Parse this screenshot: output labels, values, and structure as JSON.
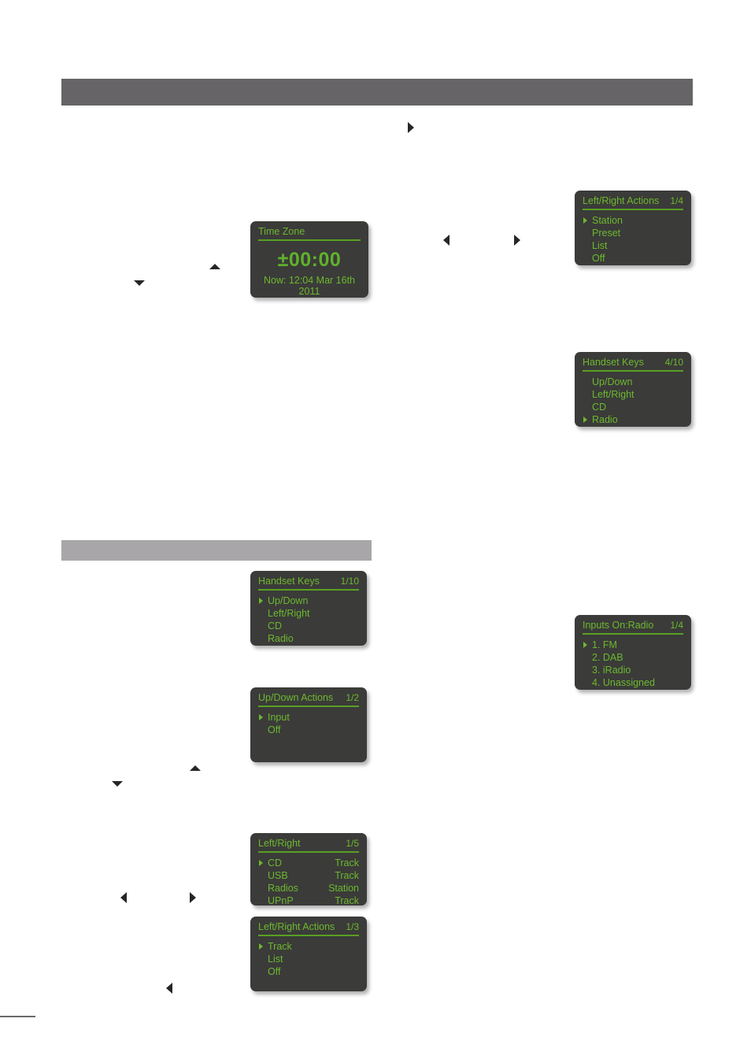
{
  "page": {
    "bands": [
      {
        "name": "section-heading-bar-primary",
        "text": ""
      },
      {
        "name": "section-heading-bar-secondary",
        "text": ""
      }
    ]
  },
  "panels": {
    "time_zone": {
      "title": "Time Zone",
      "count": "",
      "value": "±00:00",
      "now": "Now: 12:04 Mar 16th 2011"
    },
    "left_right_actions_radio": {
      "title": "Left/Right Actions",
      "count": "1/4",
      "rows": [
        {
          "label": "Station",
          "value": "",
          "selected": true
        },
        {
          "label": "Preset",
          "value": "",
          "selected": false
        },
        {
          "label": "List",
          "value": "",
          "selected": false
        },
        {
          "label": "Off",
          "value": "",
          "selected": false
        }
      ]
    },
    "handset_keys_radio": {
      "title": "Handset Keys",
      "count": "4/10",
      "rows": [
        {
          "label": "Up/Down",
          "value": "",
          "selected": false
        },
        {
          "label": "Left/Right",
          "value": "",
          "selected": false
        },
        {
          "label": "CD",
          "value": "",
          "selected": false
        },
        {
          "label": "Radio",
          "value": "",
          "selected": true
        }
      ]
    },
    "inputs_on_radio": {
      "title": "Inputs On:Radio",
      "count": "1/4",
      "rows": [
        {
          "label": "1. FM",
          "value": "",
          "selected": true
        },
        {
          "label": "2. DAB",
          "value": "",
          "selected": false
        },
        {
          "label": "3. iRadio",
          "value": "",
          "selected": false
        },
        {
          "label": "4. Unassigned",
          "value": "",
          "selected": false
        }
      ]
    },
    "handset_keys_updown": {
      "title": "Handset Keys",
      "count": "1/10",
      "rows": [
        {
          "label": "Up/Down",
          "value": "",
          "selected": true
        },
        {
          "label": "Left/Right",
          "value": "",
          "selected": false
        },
        {
          "label": "CD",
          "value": "",
          "selected": false
        },
        {
          "label": "Radio",
          "value": "",
          "selected": false
        }
      ]
    },
    "up_down_actions": {
      "title": "Up/Down Actions",
      "count": "1/2",
      "rows": [
        {
          "label": "Input",
          "value": "",
          "selected": true
        },
        {
          "label": "Off",
          "value": "",
          "selected": false
        }
      ]
    },
    "left_right": {
      "title": "Left/Right",
      "count": "1/5",
      "rows": [
        {
          "label": "CD",
          "value": "Track",
          "selected": true
        },
        {
          "label": "USB",
          "value": "Track",
          "selected": false
        },
        {
          "label": "Radios",
          "value": "Station",
          "selected": false
        },
        {
          "label": "UPnP",
          "value": "Track",
          "selected": false
        }
      ]
    },
    "left_right_actions_track": {
      "title": "Left/Right Actions",
      "count": "1/3",
      "rows": [
        {
          "label": "Track",
          "value": "",
          "selected": true
        },
        {
          "label": "List",
          "value": "",
          "selected": false
        },
        {
          "label": "Off",
          "value": "",
          "selected": false
        }
      ]
    }
  },
  "colors": {
    "panel_background": "#3b3b39",
    "panel_text_green": "#6cb82f",
    "panel_rule_green": "#58a023",
    "band_dark": "#666466",
    "band_light": "#a8a6a8",
    "glyph": "#262626"
  }
}
